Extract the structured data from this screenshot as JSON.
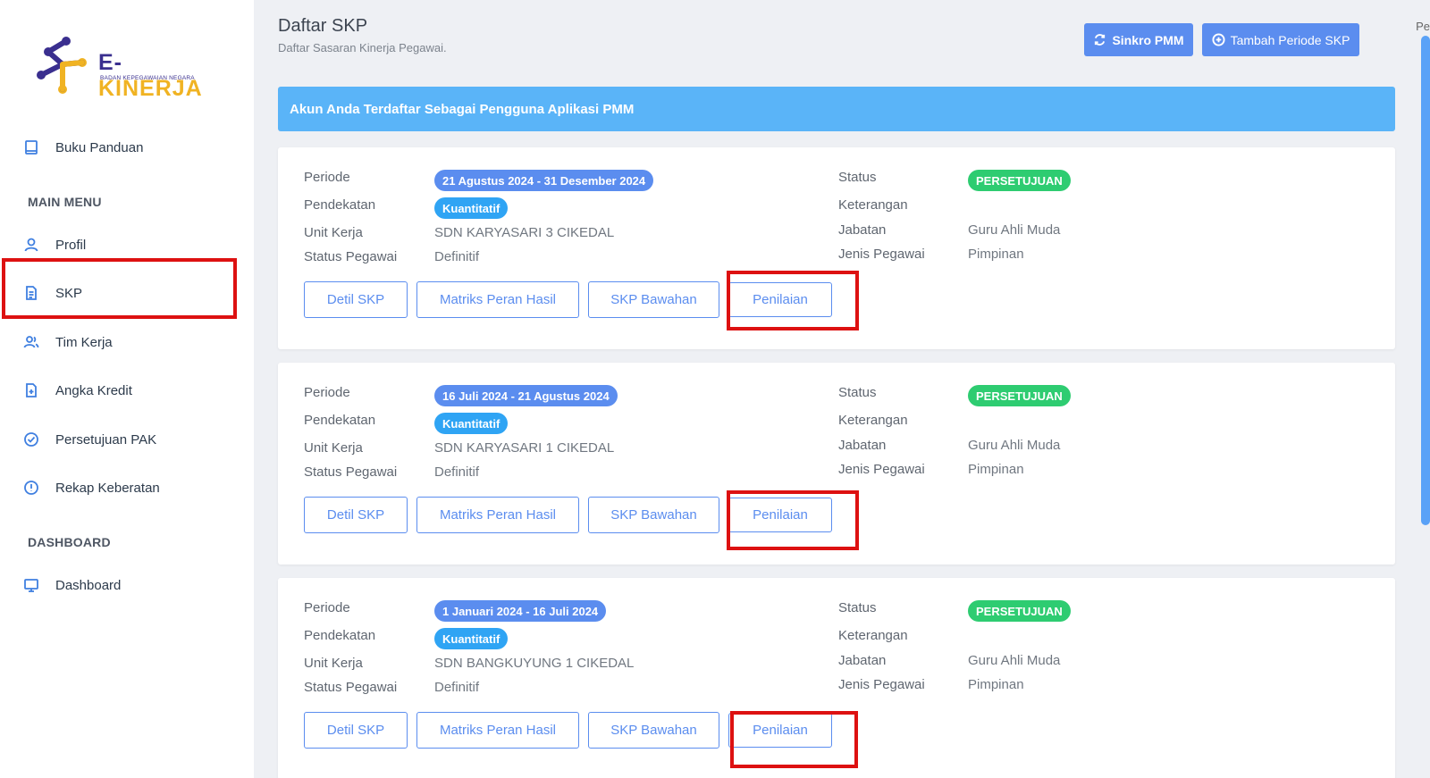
{
  "brand": {
    "name_a": "E-",
    "name_b": "KINERJA",
    "subtitle": "BADAN KEPEGAWAIAN NEGARA",
    "color_primary": "#3a2f8f",
    "color_accent": "#f0b323"
  },
  "sidebar": {
    "guide": "Buku Panduan",
    "section_main": "MAIN MENU",
    "items": [
      {
        "label": "Profil",
        "icon": "user-icon"
      },
      {
        "label": "SKP",
        "icon": "document-icon"
      },
      {
        "label": "Tim Kerja",
        "icon": "users-icon"
      },
      {
        "label": "Angka Kredit",
        "icon": "file-plus-icon"
      },
      {
        "label": "Persetujuan PAK",
        "icon": "check-circle-icon"
      },
      {
        "label": "Rekap Keberatan",
        "icon": "alert-circle-icon"
      }
    ],
    "section_dashboard": "DASHBOARD",
    "dashboard": "Dashboard"
  },
  "header": {
    "title": "Daftar SKP",
    "subtitle": "Daftar Sasaran Kinerja Pegawai.",
    "sync_button": "Sinkro PMM",
    "add_button": "Tambah Periode SKP",
    "edge_text": "Pe"
  },
  "banner": "Akun Anda Terdaftar Sebagai Pengguna Aplikasi PMM",
  "labels": {
    "periode": "Periode",
    "pendekatan": "Pendekatan",
    "unit_kerja": "Unit Kerja",
    "status_pegawai": "Status Pegawai",
    "status": "Status",
    "keterangan": "Keterangan",
    "jabatan": "Jabatan",
    "jenis_pegawai": "Jenis Pegawai"
  },
  "actions": {
    "detil": "Detil SKP",
    "matriks": "Matriks Peran Hasil",
    "bawahan": "SKP Bawahan",
    "penilaian": "Penilaian"
  },
  "cards": [
    {
      "periode": "21 Agustus 2024 - 31 Desember 2024",
      "pendekatan": "Kuantitatif",
      "unit_kerja": "SDN KARYASARI 3 CIKEDAL",
      "status_pegawai": "Definitif",
      "status": "PERSETUJUAN",
      "keterangan": "",
      "jabatan": "Guru Ahli Muda",
      "jenis_pegawai": "Pimpinan"
    },
    {
      "periode": "16 Juli 2024 - 21 Agustus 2024",
      "pendekatan": "Kuantitatif",
      "unit_kerja": "SDN KARYASARI 1 CIKEDAL",
      "status_pegawai": "Definitif",
      "status": "PERSETUJUAN",
      "keterangan": "",
      "jabatan": "Guru Ahli Muda",
      "jenis_pegawai": "Pimpinan"
    },
    {
      "periode": "1 Januari 2024 - 16 Juli 2024",
      "pendekatan": "Kuantitatif",
      "unit_kerja": "SDN BANGKUYUNG 1 CIKEDAL",
      "status_pegawai": "Definitif",
      "status": "PERSETUJUAN",
      "keterangan": "",
      "jabatan": "Guru Ahli Muda",
      "jenis_pegawai": "Pimpinan"
    }
  ],
  "colors": {
    "primary": "#5b8def",
    "banner": "#5ab4f8",
    "success": "#2ecc71",
    "highlight": "#dd1111"
  }
}
